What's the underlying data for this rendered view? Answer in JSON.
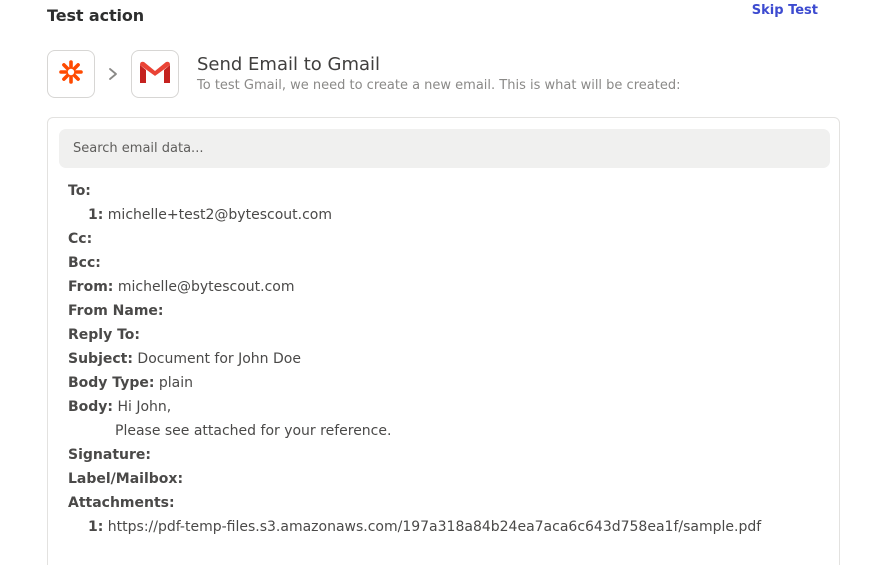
{
  "header": {
    "title": "Test action",
    "skip_label": "Skip Test"
  },
  "step": {
    "trigger_icon": "zapier-asterisk-icon",
    "action_icon": "gmail-icon",
    "title": "Send Email to Gmail",
    "subtitle": "To test Gmail, we need to create a new email. This is what will be created:"
  },
  "search": {
    "placeholder": "Search email data..."
  },
  "email": {
    "to_label": "To:",
    "to_items": [
      {
        "index": "1:",
        "value": "michelle+test2@bytescout.com"
      }
    ],
    "cc_label": "Cc:",
    "bcc_label": "Bcc:",
    "from_label": "From:",
    "from_value": "michelle@bytescout.com",
    "from_name_label": "From Name:",
    "reply_to_label": "Reply To:",
    "subject_label": "Subject:",
    "subject_value": "Document for John Doe",
    "body_type_label": "Body Type:",
    "body_type_value": "plain",
    "body_label": "Body:",
    "body_line1": "Hi John,",
    "body_line2": "Please see attached for your reference.",
    "signature_label": "Signature:",
    "label_mailbox_label": "Label/Mailbox:",
    "attachments_label": "Attachments:",
    "attachments": [
      {
        "index": "1:",
        "value": "https://pdf-temp-files.s3.amazonaws.com/197a318a84b24ea7aca6c643d758ea1f/sample.pdf"
      }
    ]
  },
  "colors": {
    "accent": "#3d4bd0",
    "zapier_orange": "#ff4a00",
    "gmail_red": "#d93025"
  }
}
